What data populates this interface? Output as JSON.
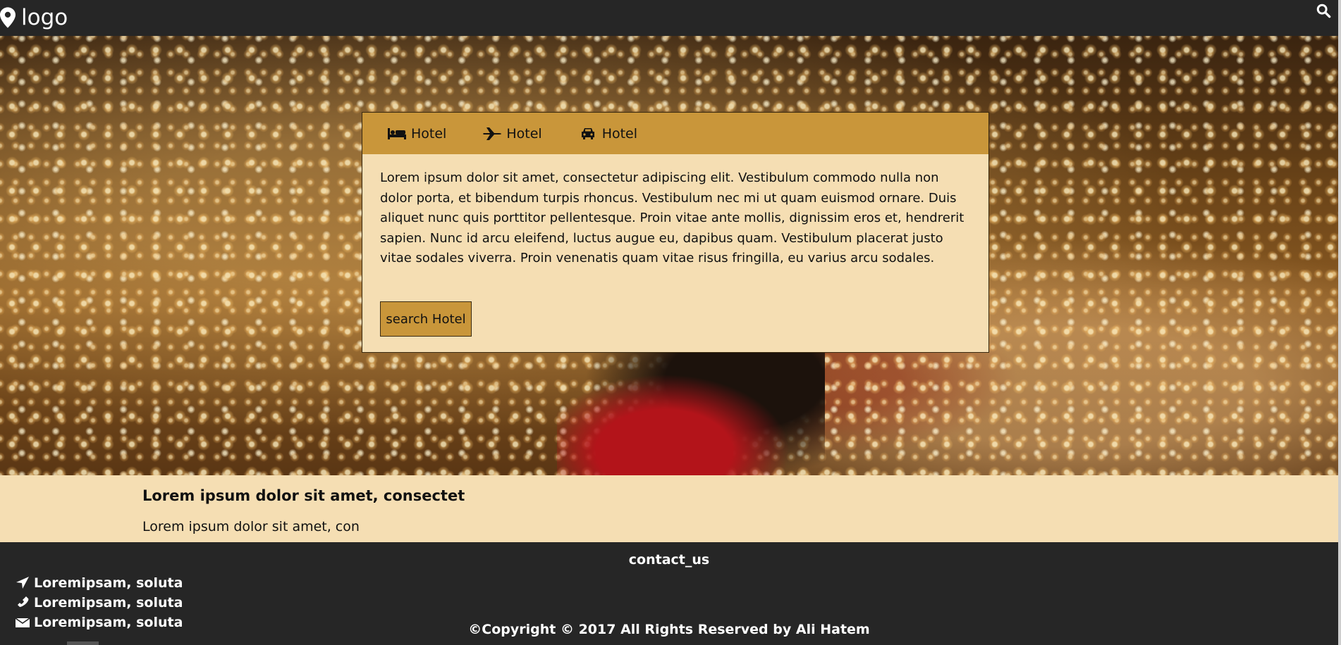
{
  "navbar": {
    "brand_label": "logo",
    "brand_icon": "map-marker-icon",
    "search_icon": "search-icon"
  },
  "panel": {
    "tabs": [
      {
        "label": "Hotel",
        "icon": "bed-icon"
      },
      {
        "label": "Hotel",
        "icon": "plane-icon"
      },
      {
        "label": "Hotel",
        "icon": "car-icon"
      }
    ],
    "text": "Lorem ipsum dolor sit amet, consectetur adipiscing elit. Vestibulum commodo nulla non dolor porta, et bibendum turpis rhoncus. Vestibulum nec mi ut quam euismod ornare. Duis aliquet nunc quis porttitor pellentesque. Proin vitae ante mollis, dignissim eros et, hendrerit sapien. Nunc id arcu eleifend, luctus augue eu, dapibus quam. Vestibulum placerat justo vitae sodales viverra. Proin venenatis quam vitae risus fringilla, eu varius arcu sodales.",
    "button_label": "search Hotel"
  },
  "info": {
    "title": "Lorem ipsum dolor sit amet, consectet",
    "body": "Lorem ipsum dolor sit amet, con"
  },
  "footer": {
    "contact_title": "contact_us",
    "items": [
      {
        "label": "Loremipsam, soluta",
        "icon": "location-arrow-icon"
      },
      {
        "label": "Loremipsam, soluta",
        "icon": "phone-icon"
      },
      {
        "label": "Loremipsam, soluta",
        "icon": "envelope-icon"
      }
    ],
    "copyright": "©Copyright © 2017 All Rights Reserved by Ali Hatem"
  },
  "colors": {
    "nav_bg": "#262626",
    "panel_bg": "#f5deb3",
    "tab_bar_bg": "#c9963a",
    "info_bg": "#f5deb3"
  }
}
